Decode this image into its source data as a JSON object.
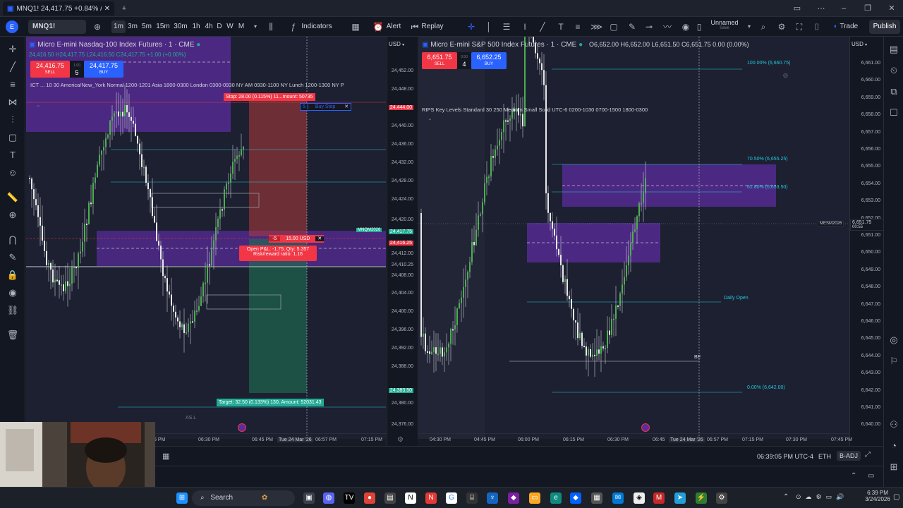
{
  "browser": {
    "tab_title": "MNQ1! 24,417.75 +0.84% /",
    "tab_close": "✕",
    "new_tab": "+"
  },
  "toolbar": {
    "symbol": "MNQ1!",
    "intervals": [
      "1m",
      "3m",
      "5m",
      "15m",
      "30m",
      "1h",
      "4h",
      "D",
      "W",
      "M"
    ],
    "indicators_label": "Indicators",
    "alert_label": "Alert",
    "replay_label": "Replay",
    "layout_name": "Unnamed",
    "layout_sub": "Save",
    "trade_label": "Trade",
    "publish_label": "Publish"
  },
  "left_chart": {
    "title": "Micro E-mini Nasdaq-100 Index Futures · 1 · CME",
    "ohlc": "24,416.50 H24,417.75 L24,416.50 C24,417.75 +1.00 (+0.00%)",
    "sell_price": "24,416.75",
    "sell_label": "SELL",
    "qty": "5",
    "buy_price": "24,417.75",
    "buy_label": "BUY",
    "spread": "1.00",
    "currency": "USD",
    "indicator_line": "ICT ...  10 30 America/New_York Normal 1200-1201 Asia 1800-0300 London 0300-0930 NY AM 0930-1100 NY Lunch 1200-1300 NY P",
    "stop_label": "Stop: 28.00 (0.115%) 11...mount: 50735",
    "buy_stop_qty": "5",
    "buy_stop_label": "Buy Stop",
    "order_qty": "-5",
    "order_value": "15.00 USD",
    "pnl_line1": "Open P&L: -1.75, Qty: 5.357",
    "pnl_line2": "Risk/reward ratio: 1.16",
    "target_label": "Target: 32.50 (0.133%) 130, Amount: 52031.43",
    "as_label": "AS.L",
    "symbol_tag": "MNQM2026",
    "prices": [
      "24,452.00",
      "24,448.00",
      "24,444.00",
      "24,440.00",
      "24,436.00",
      "24,432.00",
      "24,428.00",
      "24,424.00",
      "24,420.00",
      "24,417.75",
      "24,416.25",
      "24,412.00",
      "24,410.25",
      "24,408.00",
      "24,404.00",
      "24,400.00",
      "24,396.00",
      "24,392.00",
      "24,388.00",
      "24,383.50",
      "24,380.00",
      "24,376.00"
    ],
    "highlight_red": "24,444.00",
    "highlight_green_1": "24,417.75",
    "highlight_green_2": "24,383.50",
    "highlight_pink": "24,416.25",
    "times": [
      "5 PM",
      "06:30 PM",
      "06:45 PM",
      "Tue 24 Mar '26",
      "06:57 PM",
      "07:15 PM"
    ]
  },
  "right_chart": {
    "title": "Micro E-mini S&P 500 Index Futures · 1 · CME",
    "ohlc": "O6,652.00 H6,652.00 L6,651.50 C6,651.75 0.00 (0.00%)",
    "sell_price": "6,651.75",
    "sell_label": "SELL",
    "qty": "4",
    "buy_price": "6,652.25",
    "buy_label": "BUY",
    "spread": "0.50",
    "currency": "USD",
    "indicator_line": "RIPS Key Levels Standard 30 250 Medium Small Solid UTC-6 0200-1030 0700-1500 1800-0300",
    "fib_100": "100.00% (6,660.75)",
    "fib_70": "70.50% (6,655.25)",
    "fib_61": "61.80% (6,653.50)",
    "fib_0": "0.00% (6,642.00)",
    "daily_open": "Daily Open",
    "be_label": "BE",
    "symbol_tag": "MESM2026",
    "symbol_price": "6,651.75",
    "symbol_time": "00:55",
    "prices": [
      "6,661.00",
      "6,660.00",
      "6,659.00",
      "6,658.00",
      "6,657.00",
      "6,656.00",
      "6,655.00",
      "6,654.00",
      "6,653.00",
      "6,652.00",
      "6,651.00",
      "6,650.00",
      "6,649.00",
      "6,648.00",
      "6,647.00",
      "6,646.00",
      "6,645.00",
      "6,644.00",
      "6,643.00",
      "6,642.00",
      "6,641.00",
      "6,640.00"
    ],
    "times": [
      "04:30 PM",
      "04:45 PM",
      "06:00 PM",
      "06:15 PM",
      "06:30 PM",
      "06:45",
      "Tue 24 Mar '26",
      "06:57 PM",
      "07:15 PM",
      "07:30 PM",
      "07:45 PM"
    ]
  },
  "bottom": {
    "clock": "06:39:05 PM UTC-4",
    "session": "ETH",
    "adj": "B-ADJ"
  },
  "taskbar": {
    "search_label": "Search",
    "time": "6:39 PM",
    "date": "3/24/2026"
  },
  "colors": {
    "bg": "#171b26",
    "purple_zone": "#5b2c9e",
    "green_candle": "#4caf50",
    "red_zone": "#b33a3a",
    "teal_zone": "#1e6b52"
  }
}
